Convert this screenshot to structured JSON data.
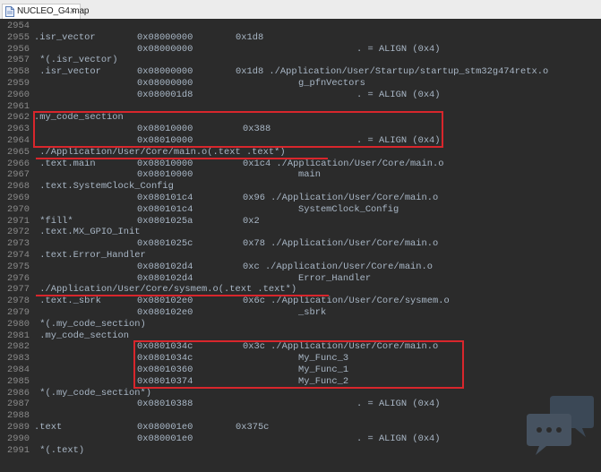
{
  "tab": {
    "label": "NUCLEO_G4.map",
    "close": "×",
    "icon": "file-icon"
  },
  "lines": [
    {
      "n": "2954",
      "s": []
    },
    {
      "n": "2955",
      "s": [
        {
          "c": ".isr_vector",
          "x": 0
        },
        {
          "c": "0x08000000",
          "x": 1
        },
        {
          "c": "0x1d8",
          "x": 2
        }
      ]
    },
    {
      "n": "2956",
      "s": [
        {
          "c": "0x08000000",
          "x": 1
        },
        {
          "c": ". = ALIGN (0x4)",
          "x": 5
        }
      ]
    },
    {
      "n": "2957",
      "s": [
        {
          "c": " *(.isr_vector)",
          "x": 0
        }
      ]
    },
    {
      "n": "2958",
      "s": [
        {
          "c": " .isr_vector",
          "x": 0
        },
        {
          "c": "0x08000000",
          "x": 1
        },
        {
          "c": "0x1d8 ./Application/User/Startup/startup_stm32g474retx.o",
          "x": 2
        }
      ]
    },
    {
      "n": "2959",
      "s": [
        {
          "c": "0x08000000",
          "x": 1
        },
        {
          "c": "g_pfnVectors",
          "x": 4
        }
      ]
    },
    {
      "n": "2960",
      "s": [
        {
          "c": "0x080001d8",
          "x": 1
        },
        {
          "c": ". = ALIGN (0x4)",
          "x": 5
        }
      ]
    },
    {
      "n": "2961",
      "s": []
    },
    {
      "n": "2962",
      "s": [
        {
          "c": ".my_code_section",
          "x": 0
        }
      ]
    },
    {
      "n": "2963",
      "s": [
        {
          "c": "0x08010000",
          "x": 1
        },
        {
          "c": "0x388",
          "x": 3
        }
      ]
    },
    {
      "n": "2964",
      "s": [
        {
          "c": "0x08010000",
          "x": 1
        },
        {
          "c": ". = ALIGN (0x4)",
          "x": 5
        }
      ]
    },
    {
      "n": "2965",
      "s": [
        {
          "c": " ./Application/User/Core/main.o(.text .text*)",
          "x": 0
        }
      ]
    },
    {
      "n": "2966",
      "s": [
        {
          "c": " .text.main",
          "x": 0
        },
        {
          "c": "0x08010000",
          "x": 1
        },
        {
          "c": "0x1c4 ./Application/User/Core/main.o",
          "x": 3
        }
      ]
    },
    {
      "n": "2967",
      "s": [
        {
          "c": "0x08010000",
          "x": 1
        },
        {
          "c": "main",
          "x": 4
        }
      ]
    },
    {
      "n": "2968",
      "s": [
        {
          "c": " .text.SystemClock_Config",
          "x": 0
        }
      ]
    },
    {
      "n": "2969",
      "s": [
        {
          "c": "0x080101c4",
          "x": 1
        },
        {
          "c": "0x96 ./Application/User/Core/main.o",
          "x": 3
        }
      ]
    },
    {
      "n": "2970",
      "s": [
        {
          "c": "0x080101c4",
          "x": 1
        },
        {
          "c": "SystemClock_Config",
          "x": 4
        }
      ]
    },
    {
      "n": "2971",
      "s": [
        {
          "c": " *fill*",
          "x": 0
        },
        {
          "c": "0x0801025a",
          "x": 1
        },
        {
          "c": "0x2",
          "x": 3
        }
      ]
    },
    {
      "n": "2972",
      "s": [
        {
          "c": " .text.MX_GPIO_Init",
          "x": 0
        }
      ]
    },
    {
      "n": "2973",
      "s": [
        {
          "c": "0x0801025c",
          "x": 1
        },
        {
          "c": "0x78 ./Application/User/Core/main.o",
          "x": 3
        }
      ]
    },
    {
      "n": "2974",
      "s": [
        {
          "c": " .text.Error_Handler",
          "x": 0
        }
      ]
    },
    {
      "n": "2975",
      "s": [
        {
          "c": "0x080102d4",
          "x": 1
        },
        {
          "c": "0xc ./Application/User/Core/main.o",
          "x": 3
        }
      ]
    },
    {
      "n": "2976",
      "s": [
        {
          "c": "0x080102d4",
          "x": 1
        },
        {
          "c": "Error_Handler",
          "x": 4
        }
      ]
    },
    {
      "n": "2977",
      "s": [
        {
          "c": " ./Application/User/Core/sysmem.o(.text .text*)",
          "x": 0
        }
      ]
    },
    {
      "n": "2978",
      "s": [
        {
          "c": " .text._sbrk",
          "x": 0
        },
        {
          "c": "0x080102e0",
          "x": 1
        },
        {
          "c": "0x6c ./Application/User/Core/sysmem.o",
          "x": 3
        }
      ]
    },
    {
      "n": "2979",
      "s": [
        {
          "c": "0x080102e0",
          "x": 1
        },
        {
          "c": "_sbrk",
          "x": 4
        }
      ]
    },
    {
      "n": "2980",
      "s": [
        {
          "c": " *(.my_code_section)",
          "x": 0
        }
      ]
    },
    {
      "n": "2981",
      "s": [
        {
          "c": " .my_code_section",
          "x": 0
        }
      ]
    },
    {
      "n": "2982",
      "s": [
        {
          "c": "0x0801034c",
          "x": 1
        },
        {
          "c": "0x3c ./Application/User/Core/main.o",
          "x": 3
        }
      ]
    },
    {
      "n": "2983",
      "s": [
        {
          "c": "0x0801034c",
          "x": 1
        },
        {
          "c": "My_Func_3",
          "x": 4
        }
      ]
    },
    {
      "n": "2984",
      "s": [
        {
          "c": "0x08010360",
          "x": 1
        },
        {
          "c": "My_Func_1",
          "x": 4
        }
      ]
    },
    {
      "n": "2985",
      "s": [
        {
          "c": "0x08010374",
          "x": 1
        },
        {
          "c": "My_Func_2",
          "x": 4
        }
      ]
    },
    {
      "n": "2986",
      "s": [
        {
          "c": " *(.my_code_section*)",
          "x": 0
        }
      ]
    },
    {
      "n": "2987",
      "s": [
        {
          "c": "0x08010388",
          "x": 1
        },
        {
          "c": ". = ALIGN (0x4)",
          "x": 5
        }
      ]
    },
    {
      "n": "2988",
      "s": []
    },
    {
      "n": "2989",
      "s": [
        {
          "c": ".text",
          "x": 0
        },
        {
          "c": "0x080001e0",
          "x": 1
        },
        {
          "c": "0x375c",
          "x": 2
        }
      ]
    },
    {
      "n": "2990",
      "s": [
        {
          "c": "0x080001e0",
          "x": 1
        },
        {
          "c": ". = ALIGN (0x4)",
          "x": 5
        }
      ]
    },
    {
      "n": "2991",
      "s": [
        {
          "c": " *(.text)",
          "x": 0
        }
      ]
    }
  ],
  "highlights": {
    "boxes": [
      {
        "name": "highlight-my-code-section-header",
        "from": "2962",
        "to": "2964"
      },
      {
        "name": "highlight-my-code-section-functions",
        "from": "2982",
        "to": "2985"
      }
    ],
    "underlines": [
      {
        "name": "underline-main-o-text",
        "line": "2965"
      },
      {
        "name": "underline-sysmem-o-text",
        "line": "2977"
      }
    ],
    "color": "#d8262c"
  },
  "colors": {
    "background": "#2b2b2b",
    "text": "#a9b7c6",
    "line_number": "#8a8a8a",
    "tabbar": "#ececec"
  }
}
